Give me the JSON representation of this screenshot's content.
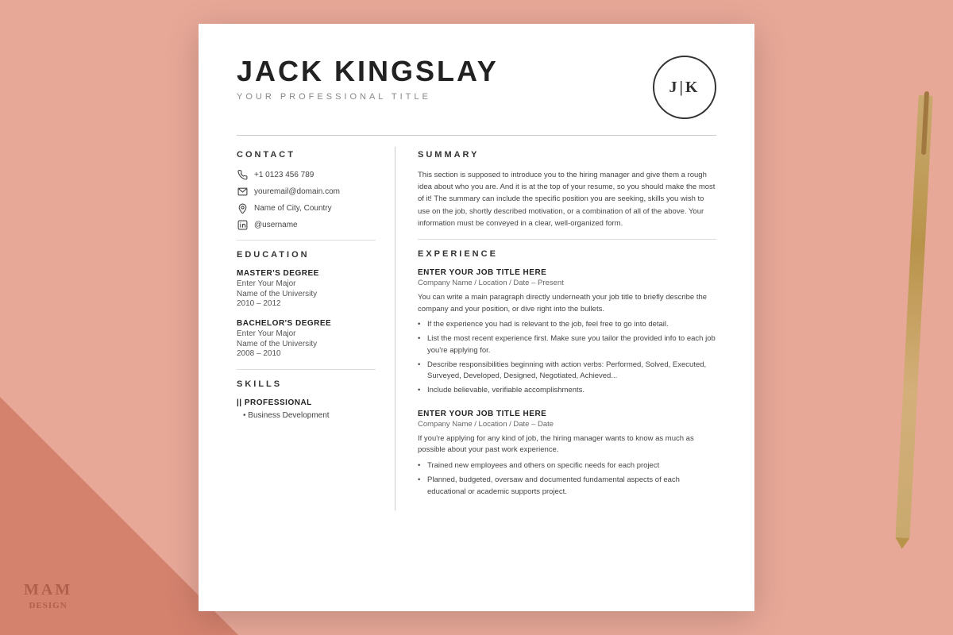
{
  "background": {
    "color": "#e8a898"
  },
  "watermark": {
    "line1": "MAM",
    "line2": "DESIGN"
  },
  "header": {
    "name": "JACK KINGSLAY",
    "title": "YOUR PROFESSIONAL TITLE",
    "monogram": "J|K"
  },
  "contact": {
    "section_label": "CONTACT",
    "phone": "+1 0123 456 789",
    "email": "youremail@domain.com",
    "location": "Name of City, Country",
    "linkedin": "@username"
  },
  "education": {
    "section_label": "EDUCATION",
    "degrees": [
      {
        "degree": "MASTER'S DEGREE",
        "major": "Enter Your Major",
        "school": "Name of the University",
        "years": "2010 – 2012"
      },
      {
        "degree": "BACHELOR'S DEGREE",
        "major": "Enter Your Major",
        "school": "Name of the University",
        "years": "2008 – 2010"
      }
    ]
  },
  "skills": {
    "section_label": "SKILLS",
    "category": "|| PROFESSIONAL",
    "items": [
      "Business Development"
    ]
  },
  "summary": {
    "section_label": "SUMMARY",
    "text": "This section is supposed to introduce you to the hiring manager and give them a rough idea about who you are. And it is at the top of your resume, so you should make the most of it! The summary can include the specific position you are seeking, skills you wish to use on the job, shortly described motivation, or a combination of all of the above. Your information must be conveyed in a clear, well-organized form."
  },
  "experience": {
    "section_label": "EXPERIENCE",
    "jobs": [
      {
        "title": "ENTER YOUR JOB TITLE HERE",
        "company": "Company Name  /  Location  /  Date – Present",
        "description": "You can write a main paragraph directly underneath your job title to briefly describe the company and your position, or dive right into the bullets.",
        "bullets": [
          "If the experience you had is relevant to the job, feel free to go into detail.",
          "List the most recent experience first. Make sure you tailor the provided info to each job you're applying for.",
          "Describe responsibilities beginning with action verbs: Performed, Solved, Executed, Surveyed, Developed, Designed, Negotiated, Achieved...",
          "Include believable, verifiable accomplishments."
        ]
      },
      {
        "title": "ENTER YOUR JOB TITLE HERE",
        "company": "Company Name  /  Location  /  Date – Date",
        "description": "If you're applying for any kind of job, the hiring manager wants to know as much as possible about your past work experience.",
        "bullets": [
          "Trained new employees and others on specific needs for each project",
          "Planned, budgeted, oversaw and documented fundamental aspects of each educational or academic supports project."
        ]
      }
    ]
  }
}
